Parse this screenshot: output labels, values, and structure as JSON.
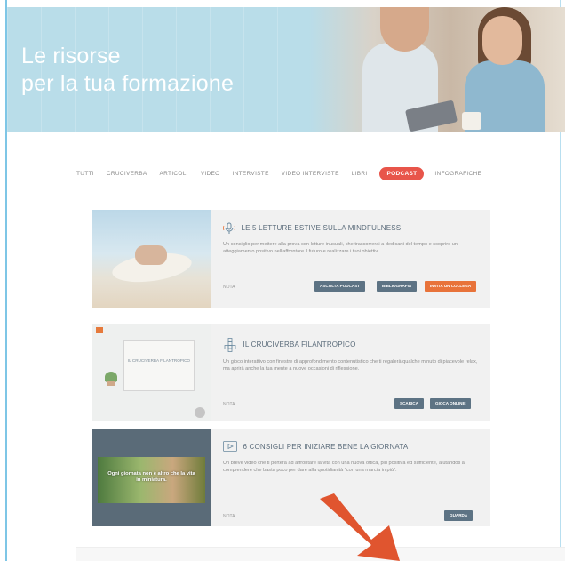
{
  "hero": {
    "title_line1": "Le risorse",
    "title_line2": "per la tua formazione"
  },
  "tabs": [
    {
      "label": "TUTTI",
      "active": false
    },
    {
      "label": "CRUCIVERBA",
      "active": false
    },
    {
      "label": "ARTICOLI",
      "active": false
    },
    {
      "label": "VIDEO",
      "active": false
    },
    {
      "label": "INTERVISTE",
      "active": false
    },
    {
      "label": "VIDEO INTERVISTE",
      "active": false
    },
    {
      "label": "LIBRI",
      "active": false
    },
    {
      "label": "PODCAST",
      "active": true
    },
    {
      "label": "INFOGRAFICHE",
      "active": false
    }
  ],
  "cards": [
    {
      "icon": "podcast-microphone-icon",
      "title": "LE 5 LETTURE ESTIVE SULLA MINDFULNESS",
      "description": "Un consiglio per mettere alla prova con letture inusuali, che trascorrerai a dedicarti del tempo e scoprire un atteggiamento positivo nell'affrontare il futuro e realizzare i tuoi obiettivi.",
      "meta": "NOTA",
      "buttons": [
        "ASCOLTA PODCAST",
        "BIBLIOGRAFIA",
        "INVITA UN COLLEGA"
      ]
    },
    {
      "icon": "crossword-icon",
      "title": "IL CRUCIVERBA FILANTROPICO",
      "description": "Un gioco interattivo con finestre di approfondimento contenutistico che ti regalerà qualche minuto di piacevole relax, ma aprirà anche la tua mente a nuove occasioni di riflessione.",
      "meta": "NOTA",
      "thumb_text": "IL CRUCIVERBA FILANTROPICO",
      "buttons": [
        "SCARICA",
        "GIOCA ONLINE"
      ]
    },
    {
      "icon": "video-play-icon",
      "title": "6 CONSIGLI PER INIZIARE BENE LA GIORNATA",
      "description": "Un breve video che ti porterà ad affrontare la vita con una nuova ottica, più positiva ed sufficiente, aiutandoti a comprendere che basta poco per dare alla quotidianità \"con una marcia in più\".",
      "meta": "NOTA",
      "thumb_text": "Ogni giornata non è altro che la vita in miniatura.",
      "buttons": [
        "GUARDA"
      ]
    }
  ],
  "colors": {
    "hero_bg": "#b9dde9",
    "accent_orange": "#e8733a",
    "active_tab": "#e8554a",
    "button_slate": "#5d7384"
  }
}
